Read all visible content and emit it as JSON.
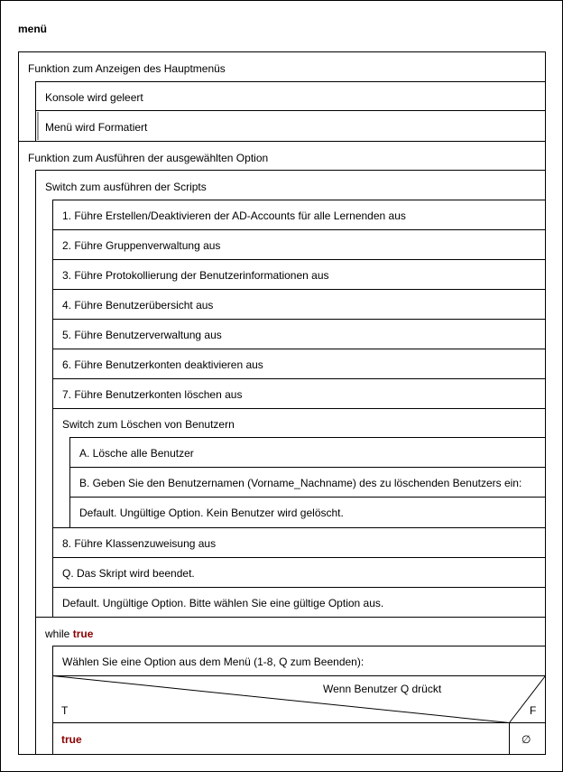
{
  "diagram": {
    "title": "menü",
    "menu_function": {
      "label": "Funktion zum Anzeigen des Hauptmenüs",
      "steps": [
        "Konsole wird geleert",
        "Menü wird Formatiert"
      ]
    },
    "exec_function": {
      "label": "Funktion zum Ausführen der ausgewählten Option",
      "switch_label": "Switch zum ausführen der Scripts",
      "cases": [
        "1. Führe Erstellen/Deaktivieren der AD-Accounts für alle Lernenden aus",
        "2. Führe Gruppenverwaltung aus",
        "3. Führe Protokollierung der Benutzerinformationen aus",
        "4. Führe Benutzerübersicht aus",
        "5. Führe Benutzerverwaltung aus",
        "6. Führe Benutzerkonten deaktivieren aus",
        "7. Führe Benutzerkonten löschen aus"
      ],
      "delete_switch": {
        "label": "Switch zum Löschen von Benutzern",
        "cases": [
          "A. Lösche alle Benutzer",
          "B. Geben Sie den Benutzernamen (Vorname_Nachname) des zu löschenden Benutzers ein:",
          "Default. Ungültige Option. Kein Benutzer wird gelöscht."
        ]
      },
      "cases_after": [
        "8. Führe Klassenzuweisung aus",
        "Q. Das Skript wird beendet.",
        "Default. Ungültige Option. Bitte wählen Sie eine gültige Option aus."
      ]
    },
    "loop": {
      "keyword": "while",
      "condition": "true",
      "prompt": "Wählen Sie eine Option aus dem Menü (1-8, Q zum Beenden):",
      "decision": {
        "condition": "Wenn Benutzer Q drückt",
        "true_label": "T",
        "false_label": "F",
        "true_branch": "true",
        "false_branch": "∅"
      }
    }
  }
}
